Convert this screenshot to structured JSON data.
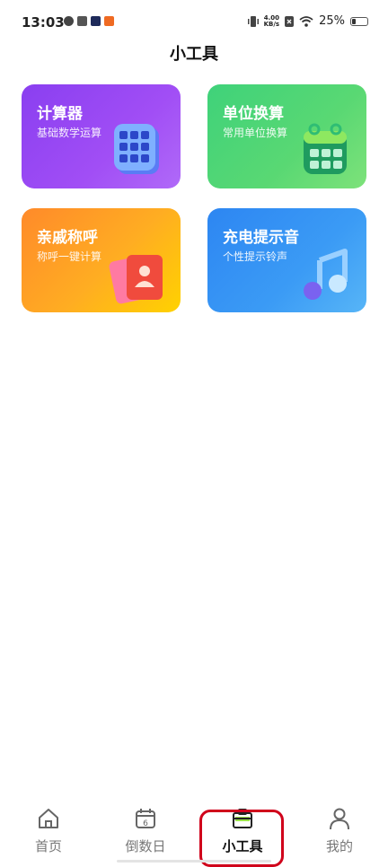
{
  "status_bar": {
    "time": "13:03",
    "net_speed_value": "4.00",
    "net_speed_unit": "KB/s",
    "battery_text": "25%",
    "battery_level": 0.25,
    "icons": [
      "vibrate-icon",
      "speed-icon",
      "sim-x-icon",
      "wifi-icon",
      "battery-icon"
    ],
    "notification_icons": [
      "leaf-icon",
      "app-icon",
      "video-icon",
      "gift-icon"
    ]
  },
  "page": {
    "title": "小工具"
  },
  "tools": [
    {
      "title": "计算器",
      "subtitle": "基础数学运算",
      "icon": "calculator-icon"
    },
    {
      "title": "单位换算",
      "subtitle": "常用单位换算",
      "icon": "calendar-icon"
    },
    {
      "title": "亲戚称呼",
      "subtitle": "称呼一键计算",
      "icon": "contact-card-icon"
    },
    {
      "title": "充电提示音",
      "subtitle": "个性提示铃声",
      "icon": "music-note-icon"
    }
  ],
  "nav": {
    "items": [
      {
        "label": "首页",
        "icon": "home-icon"
      },
      {
        "label": "倒数日",
        "icon": "calendar-6-icon",
        "icon_text": "6"
      },
      {
        "label": "小工具",
        "icon": "toolbox-icon",
        "active": true
      },
      {
        "label": "我的",
        "icon": "person-icon"
      }
    ]
  },
  "colors": {
    "highlight": "#d0021b",
    "card_purple": "#9a46f4",
    "card_green": "#4fd576",
    "card_orange": "#ffa623",
    "card_blue": "#3592f4"
  }
}
